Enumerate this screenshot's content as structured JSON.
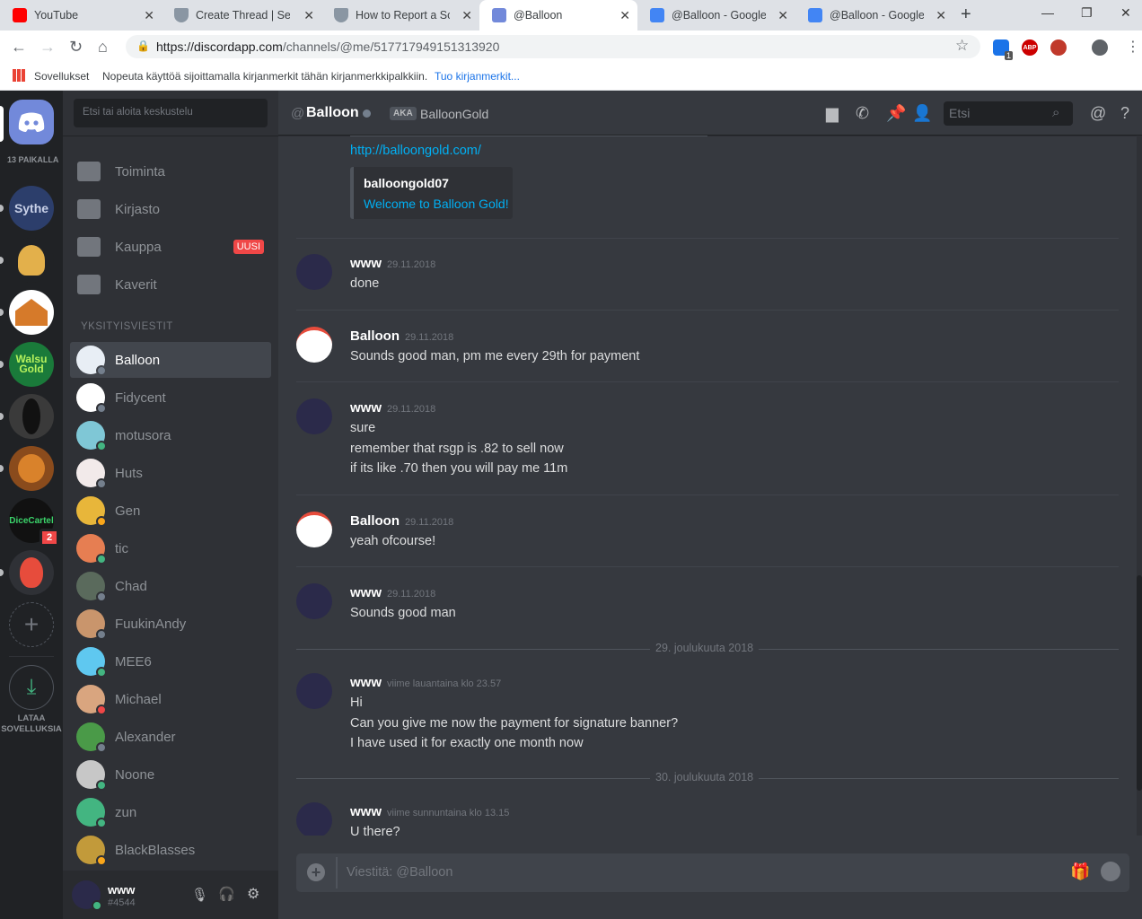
{
  "browser": {
    "tabs": [
      {
        "title": "YouTube",
        "fav_color": "#ff0000"
      },
      {
        "title": "Create Thread | Sell &",
        "fav_color": "#6b7c8f"
      },
      {
        "title": "How to Report a Scam",
        "fav_color": "#6b7c8f"
      },
      {
        "title": "@Balloon",
        "fav_color": "#7289da"
      },
      {
        "title": "@Balloon - Google C",
        "fav_color": "#4285f4"
      },
      {
        "title": "@Balloon - Google C",
        "fav_color": "#4285f4"
      }
    ],
    "new_tab": "+",
    "url_host": "https://discordapp.com",
    "url_path": "/channels/@me/517717949151313920",
    "bookmarks": {
      "apps": "Sovellukset",
      "hint": "Nopeuta käyttöä sijoittamalla kirjanmerkit tähän kirjanmerkkipalkkiin.",
      "import": "Tuo kirjanmerkit..."
    },
    "ext_badge": "1",
    "abp": "ABP"
  },
  "guilds": {
    "online": "13 PAIKALLA",
    "download": "LATAA SOVELLUKSIA",
    "dicecartel": "DiceCartel",
    "sythe": "Sythe",
    "wg": "Walsu Gold",
    "mention_badge": "2"
  },
  "sidebar": {
    "search_placeholder": "Etsi tai aloita keskustelu",
    "nav": [
      "Toiminta",
      "Kirjasto",
      "Kauppa",
      "Kaverit"
    ],
    "new_badge": "UUSI",
    "dm_header": "YKSITYISVIESTIT",
    "dms": [
      {
        "name": "Balloon",
        "status": "#747f8d",
        "color": "#e8eef5"
      },
      {
        "name": "Fidycent",
        "status": "#747f8d",
        "color": "#ffffff"
      },
      {
        "name": "motusora",
        "status": "#43b581",
        "color": "#7fc7d6"
      },
      {
        "name": "Huts",
        "status": "#747f8d",
        "color": "#f2eaea"
      },
      {
        "name": "Gen",
        "status": "#faa61a",
        "color": "#e8b63a"
      },
      {
        "name": "tic",
        "status": "#43b581",
        "color": "#e67e52"
      },
      {
        "name": "Chad",
        "status": "#747f8d",
        "color": "#5a6a5c"
      },
      {
        "name": "FuukinAndy",
        "status": "#747f8d",
        "color": "#c9956c"
      },
      {
        "name": "MEE6",
        "status": "#43b581",
        "color": "#5fc8f0"
      },
      {
        "name": "Michael",
        "status": "#f04747",
        "color": "#d9a57f"
      },
      {
        "name": "Alexander",
        "status": "#747f8d",
        "color": "#4a9a48"
      },
      {
        "name": "Noone",
        "status": "#43b581",
        "color": "#c7c7c7"
      },
      {
        "name": "zun",
        "status": "#43b581",
        "color": "#43b581"
      },
      {
        "name": "BlackBlasses",
        "status": "#faa61a",
        "color": "#c29a3a"
      }
    ],
    "user": {
      "name": "www",
      "tag": "#4544"
    }
  },
  "header": {
    "at": "@",
    "name": "Balloon",
    "aka": "AKA",
    "aka_name": "BalloonGold",
    "search_placeholder": "Etsi"
  },
  "messages": {
    "link": "http://balloongold.com/",
    "embed_title": "balloongold07",
    "embed_link": "Welcome to Balloon Gold!",
    "groups": [
      {
        "author": "www",
        "time": "29.11.2018",
        "lines": [
          "done"
        ],
        "bal": false
      },
      {
        "author": "Balloon",
        "time": "29.11.2018",
        "lines": [
          "Sounds good man, pm me every 29th for payment"
        ],
        "bal": true
      },
      {
        "author": "www",
        "time": "29.11.2018",
        "lines": [
          "sure",
          "remember that rsgp is .82 to sell now",
          "if its like .70 then you will pay me 11m"
        ],
        "bal": false
      },
      {
        "author": "Balloon",
        "time": "29.11.2018",
        "lines": [
          "yeah ofcourse!"
        ],
        "bal": true
      },
      {
        "author": "www",
        "time": "29.11.2018",
        "lines": [
          "Sounds good man"
        ],
        "bal": false
      },
      {
        "author": "www",
        "time": "viime lauantaina klo 23.57",
        "lines": [
          "Hi",
          "Can you give me now the payment for signature banner?",
          "I have used it for exactly one month now"
        ],
        "bal": false
      },
      {
        "author": "www",
        "time": "viime sunnuntaina klo 13.15",
        "lines": [
          "U there?"
        ],
        "bal": false
      }
    ],
    "date1": "29. joulukuuta 2018",
    "date2": "30. joulukuuta 2018"
  },
  "composer": {
    "placeholder": "Viestitä: @Balloon"
  },
  "colors": {
    "accent": "#7289da",
    "link": "#00b0f4",
    "online": "#43b581",
    "dnd": "#f04747",
    "idle": "#faa61a"
  }
}
